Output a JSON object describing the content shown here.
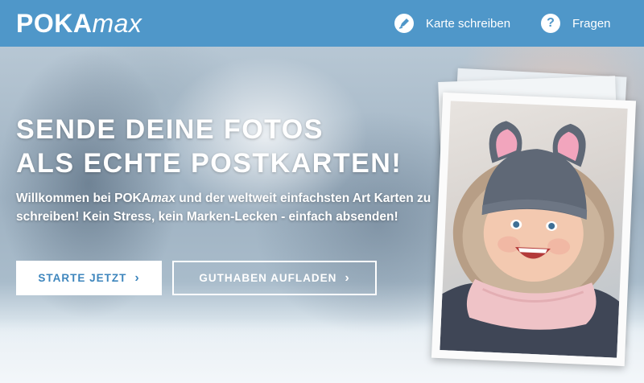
{
  "header": {
    "logo_bold": "POKA",
    "logo_light": "max",
    "nav": [
      {
        "label": "Karte schreiben",
        "icon": "pen-icon"
      },
      {
        "label": "Fragen",
        "icon": "question-icon"
      }
    ]
  },
  "hero": {
    "headline_line1": "SENDE DEINE FOTOS",
    "headline_line2": "ALS ECHTE POSTKARTEN!",
    "intro_part1": "Willkommen bei POKA",
    "intro_brand_em": "max",
    "intro_part2": " und der weltweit einfachsten Art Karten zu schreiben! Kein Stress, kein Marken-Lecken - einfach absenden!",
    "buttons": {
      "start": "STARTE JETZT",
      "credit": "GUTHABEN AUFLADEN"
    }
  },
  "colors": {
    "brand_blue": "#4f97c9",
    "button_text_blue": "#3e86bd",
    "white": "#ffffff"
  }
}
